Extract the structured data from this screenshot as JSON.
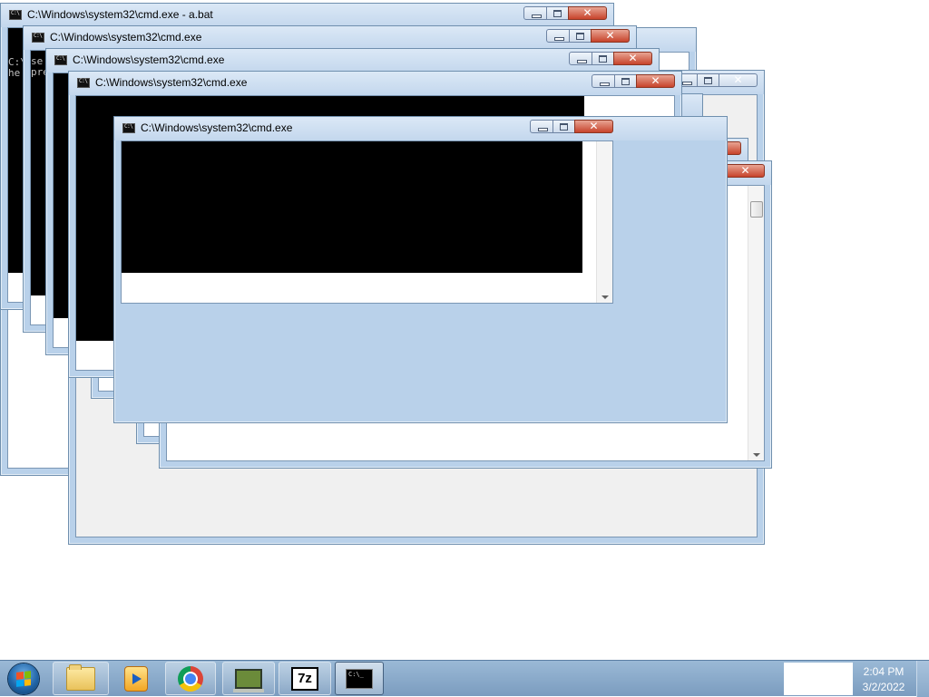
{
  "windows": [
    {
      "id": "w-back-1",
      "title": "",
      "client": "white"
    },
    {
      "id": "w-back-2",
      "title": "",
      "client": "grey"
    },
    {
      "id": "w-back-3",
      "title": "",
      "client": "white"
    },
    {
      "id": "w-back-4",
      "title": "",
      "client": "white"
    },
    {
      "id": "w-back-5",
      "title": "",
      "client": "white"
    },
    {
      "id": "w-back-6",
      "title": "",
      "client": "white"
    },
    {
      "id": "w-abat",
      "title": "C:\\Windows\\system32\\cmd.exe - a.bat",
      "client": "console"
    },
    {
      "id": "w-cmd-2",
      "title": "C:\\Windows\\system32\\cmd.exe",
      "client": "console"
    },
    {
      "id": "w-cmd-3",
      "title": "C:\\Windows\\system32\\cmd.exe",
      "client": "console"
    },
    {
      "id": "w-cmd-4",
      "title": "C:\\Windows\\system32\\cmd.exe",
      "client": "console"
    },
    {
      "id": "w-cmd-5",
      "title": "C:\\Windows\\system32\\cmd.exe",
      "client": "console"
    }
  ],
  "console_fragments": {
    "abat_lines": [
      "C:\\",
      "he",
      "",
      "",
      ""
    ],
    "cmd2_lines": [
      "se",
      "pre"
    ]
  },
  "taskbar": {
    "apps": [
      {
        "name": "windows-explorer",
        "icon": "folder-icon"
      },
      {
        "name": "media-player",
        "icon": "media-player-icon"
      },
      {
        "name": "google-chrome",
        "icon": "chrome-icon"
      },
      {
        "name": "system-monitor",
        "icon": "monitor-icon"
      },
      {
        "name": "7-zip",
        "icon": "7zip-icon",
        "label": "7z"
      },
      {
        "name": "command-prompt",
        "icon": "cmd-icon",
        "label": "C:\\_"
      }
    ],
    "clock": {
      "time": "2:04 PM",
      "date": "3/2/2022"
    }
  },
  "colors": {
    "frame": "#b9d1ea",
    "close": "#c7432b",
    "taskbar": "#8aaccf"
  }
}
